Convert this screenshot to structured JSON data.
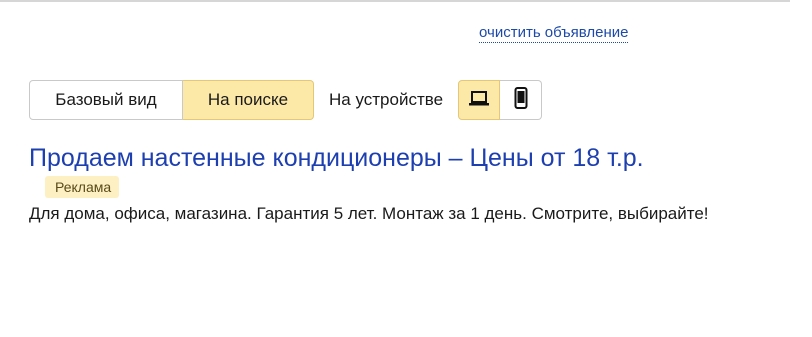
{
  "header": {
    "clear_link": "очистить объявление"
  },
  "view_modes": {
    "items": [
      {
        "label": "Базовый вид",
        "active": false
      },
      {
        "label": "На поиске",
        "active": true
      }
    ]
  },
  "device": {
    "label": "На устройстве",
    "options": [
      {
        "icon": "laptop-icon",
        "active": true
      },
      {
        "icon": "smartphone-icon",
        "active": false
      }
    ]
  },
  "ad": {
    "title": "Продаем настенные кондиционеры – Цены от 18 т.р.",
    "badge": "Реклама",
    "text": "Для дома, офиса, магазина. Гарантия 5 лет. Монтаж за 1 день. Смотрите, выбирайте!"
  },
  "colors": {
    "link": "#1d3fb0",
    "active_bg": "#fde9a7",
    "badge_bg": "#fdf0c2"
  }
}
